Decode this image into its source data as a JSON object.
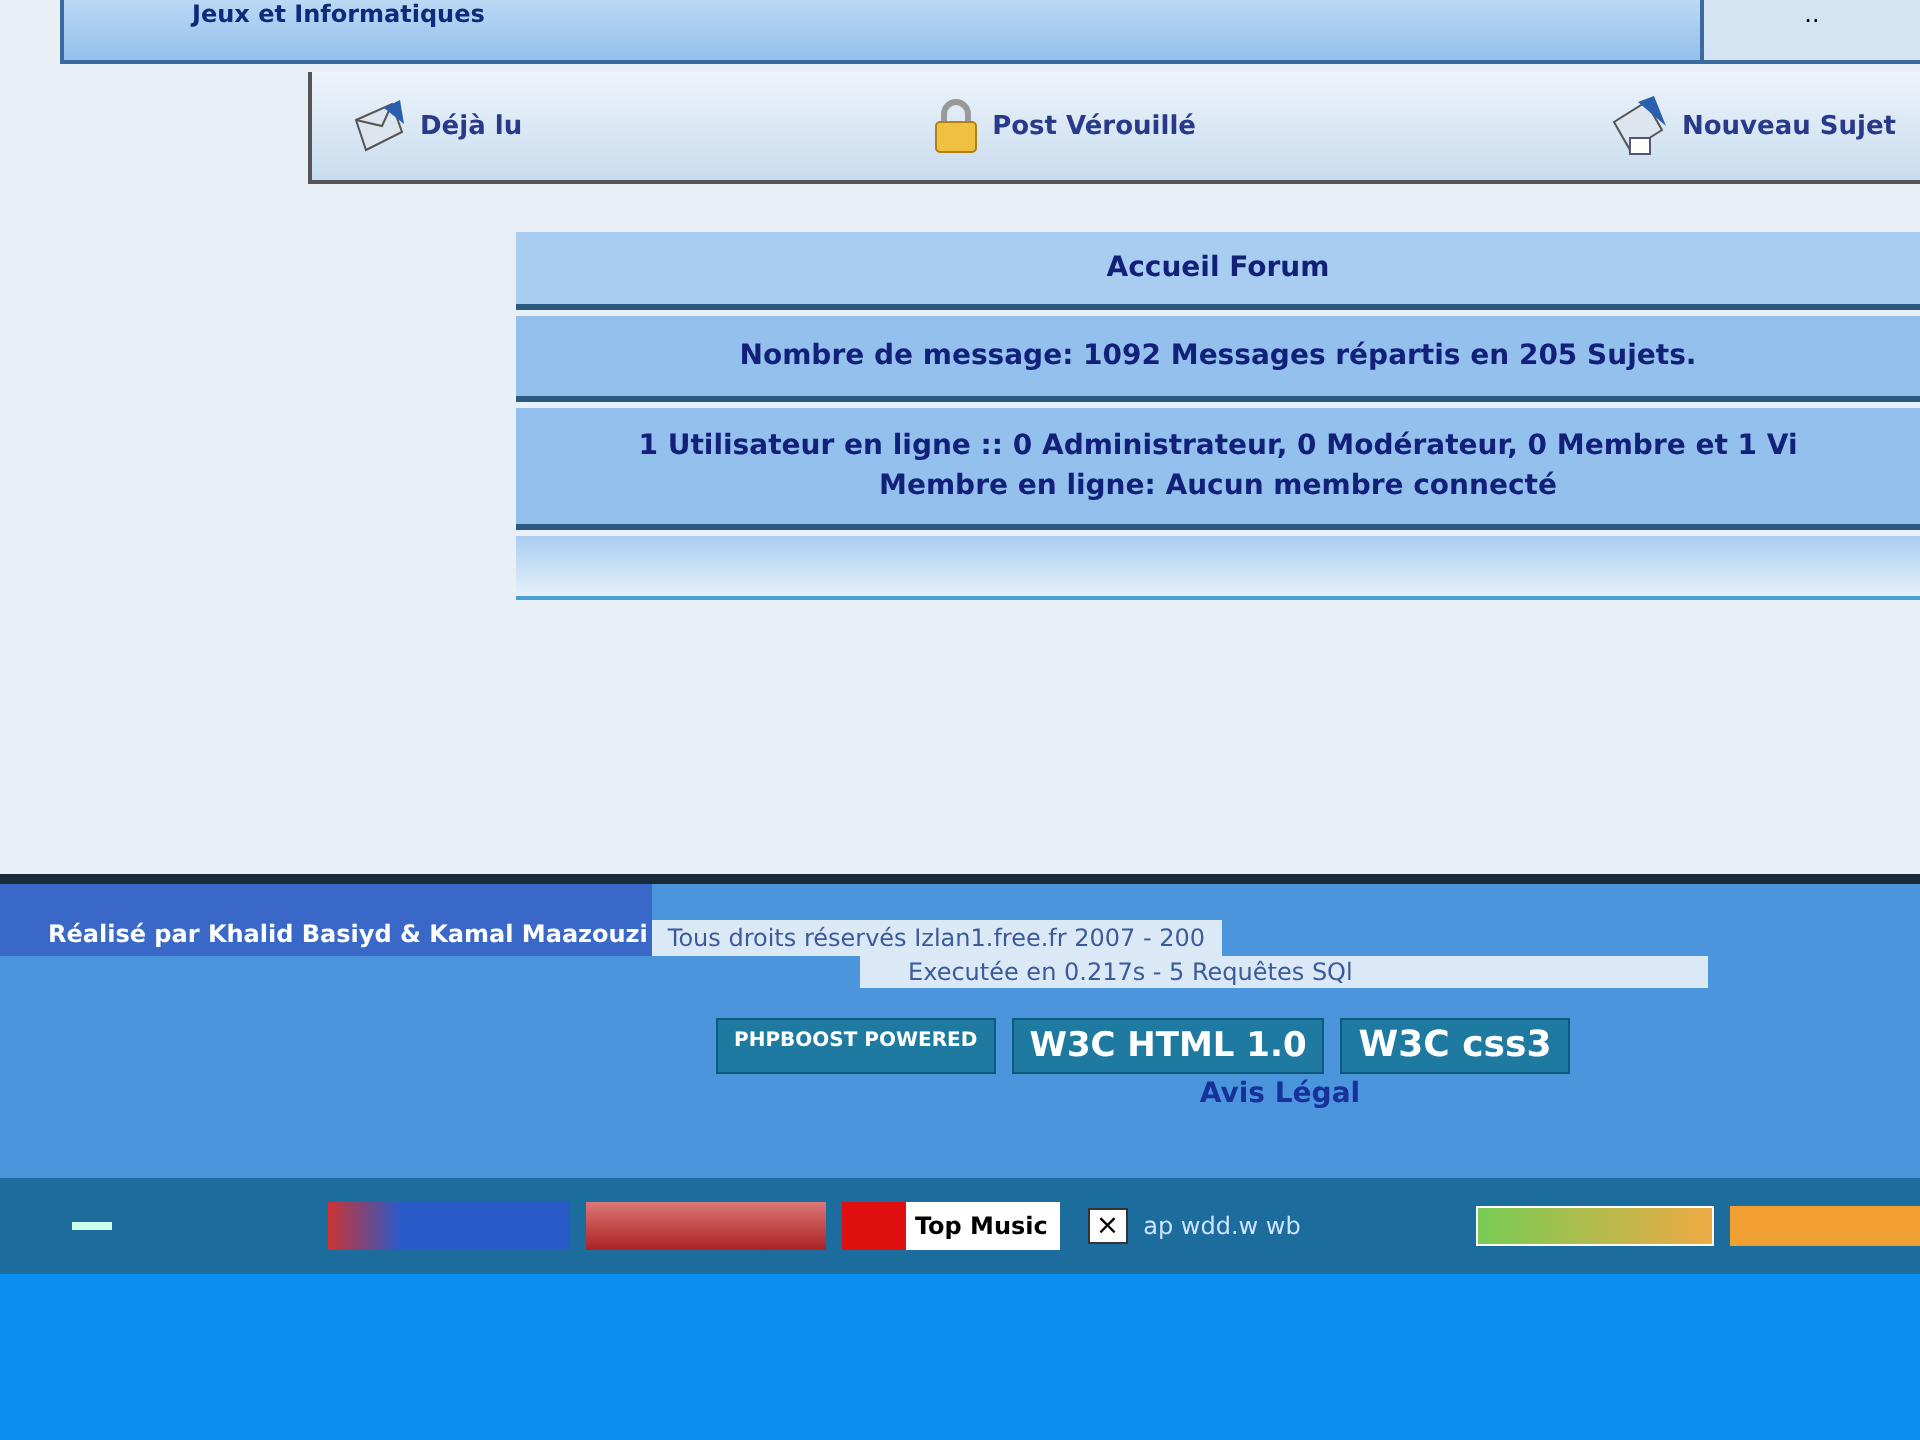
{
  "top_bar": {
    "title": "Jeux et Informatiques",
    "corner": ".."
  },
  "legend": [
    {
      "kind": "read",
      "label": "Déjà lu"
    },
    {
      "kind": "locked",
      "label": "Post Vérouillé"
    },
    {
      "kind": "new",
      "label": "Nouveau Sujet"
    }
  ],
  "stats": {
    "header": "Accueil Forum",
    "messages": "Nombre de message: 1092 Messages répartis en 205 Sujets.",
    "online": "1 Utilisateur en ligne :: 0 Administrateur, 0 Modérateur, 0 Membre et 1 Vi",
    "members": "Membre en ligne: Aucun membre connecté"
  },
  "footer": {
    "credits": "Réalisé par Khalid Basiyd & Kamal Maazouzi",
    "rights": "Tous droits réservés   Izlan1.free.fr 2007 - 200",
    "timing": "Executée en 0.217s - 5 Requêtes SQl",
    "badges": [
      "PHPBOOST POWERED",
      "W3C HTML 1.0",
      "W3C css3"
    ],
    "legal": "Avis Légal"
  },
  "bottom_bar": {
    "banner": "Top Music",
    "close": "×",
    "text": "ap wdd.w wb"
  }
}
